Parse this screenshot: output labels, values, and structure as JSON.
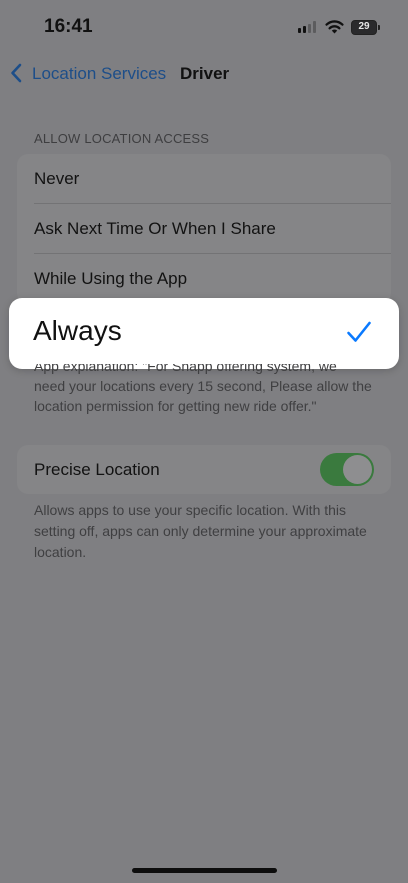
{
  "status_bar": {
    "time": "16:41",
    "battery_level": "29"
  },
  "nav": {
    "back_label": "Location Services",
    "title": "Driver"
  },
  "allow_access": {
    "header": "ALLOW LOCATION ACCESS",
    "options": [
      {
        "label": "Never"
      },
      {
        "label": "Ask Next Time Or When I Share"
      },
      {
        "label": "While Using the App"
      },
      {
        "label": "Always",
        "selected": true
      }
    ]
  },
  "explanation": {
    "line1": "App explanation: \"For Snapp offering system, we",
    "line2": "need your locations every 15 second, Please allow the",
    "line3": "location permission for getting new ride offer.\""
  },
  "precise_location": {
    "label": "Precise Location",
    "enabled": true,
    "footer": "Allows apps to use your specific location. With this setting off, apps can only determine your approximate location."
  },
  "colors": {
    "accent": "#0a7aff",
    "toggle_on": "#34c759",
    "dim_overlay": "#7f7f82"
  }
}
